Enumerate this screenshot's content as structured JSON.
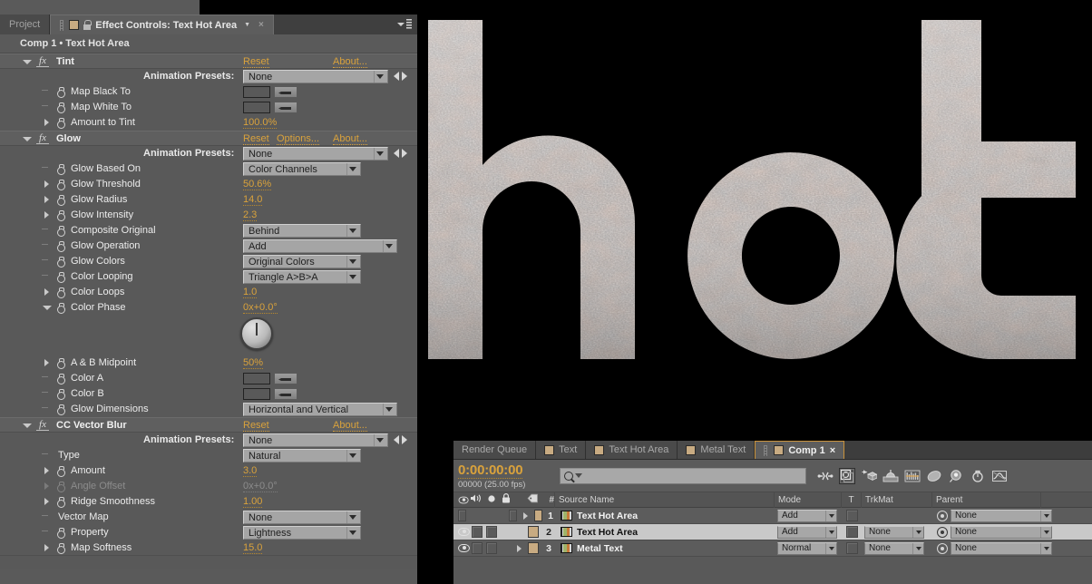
{
  "effect_controls": {
    "tabs": [
      {
        "label": "Project",
        "active": false,
        "icon": null
      },
      {
        "label": "Effect Controls: Text Hot Area",
        "active": true,
        "icon": "swatch-lock"
      }
    ],
    "breadcrumb": "Comp 1 • Text Hot Area",
    "panel_menu_icon": "panel-menu-icon",
    "effects": [
      {
        "name": "Tint",
        "expanded": true,
        "links": [
          "Reset",
          "About..."
        ],
        "animation_presets_label": "Animation Presets:",
        "animation_presets_value": "None",
        "properties": [
          {
            "label": "Map Black To",
            "type": "color",
            "value": "#000000",
            "has_stopwatch": true,
            "expandable": false
          },
          {
            "label": "Map White To",
            "type": "color",
            "value": "#f04516",
            "has_stopwatch": true,
            "expandable": false
          },
          {
            "label": "Amount to Tint",
            "type": "number",
            "value": "100.0%",
            "has_stopwatch": true,
            "expandable": true
          }
        ]
      },
      {
        "name": "Glow",
        "expanded": true,
        "links": [
          "Reset",
          "Options...",
          "About..."
        ],
        "animation_presets_label": "Animation Presets:",
        "animation_presets_value": "None",
        "properties": [
          {
            "label": "Glow Based On",
            "type": "dropdown",
            "value": "Color Channels",
            "has_stopwatch": true,
            "expandable": false,
            "width": 130
          },
          {
            "label": "Glow Threshold",
            "type": "number",
            "value": "50.6%",
            "has_stopwatch": true,
            "expandable": true
          },
          {
            "label": "Glow Radius",
            "type": "number",
            "value": "14.0",
            "has_stopwatch": true,
            "expandable": true
          },
          {
            "label": "Glow Intensity",
            "type": "number",
            "value": "2.3",
            "has_stopwatch": true,
            "expandable": true
          },
          {
            "label": "Composite Original",
            "type": "dropdown",
            "value": "Behind",
            "has_stopwatch": true,
            "expandable": false,
            "width": 130
          },
          {
            "label": "Glow Operation",
            "type": "dropdown",
            "value": "Add",
            "has_stopwatch": true,
            "expandable": false,
            "width": 170
          },
          {
            "label": "Glow Colors",
            "type": "dropdown",
            "value": "Original Colors",
            "has_stopwatch": true,
            "expandable": false,
            "width": 130
          },
          {
            "label": "Color Looping",
            "type": "dropdown",
            "value": "Triangle A>B>A",
            "has_stopwatch": true,
            "expandable": false,
            "width": 130
          },
          {
            "label": "Color Loops",
            "type": "number",
            "value": "1.0",
            "has_stopwatch": true,
            "expandable": true
          },
          {
            "label": "Color Phase",
            "type": "angle",
            "value": "0x+0.0°",
            "has_stopwatch": true,
            "expandable": true,
            "expanded": true,
            "dial": true
          },
          {
            "label": "A & B Midpoint",
            "type": "number",
            "value": "50%",
            "has_stopwatch": true,
            "expandable": true
          },
          {
            "label": "Color A",
            "type": "color",
            "value": "#ffffff",
            "has_stopwatch": true,
            "expandable": false
          },
          {
            "label": "Color B",
            "type": "color",
            "value": "#000000",
            "has_stopwatch": true,
            "expandable": false
          },
          {
            "label": "Glow Dimensions",
            "type": "dropdown",
            "value": "Horizontal and Vertical",
            "has_stopwatch": true,
            "expandable": false,
            "width": 170
          }
        ]
      },
      {
        "name": "CC Vector Blur",
        "expanded": true,
        "links": [
          "Reset",
          "About..."
        ],
        "animation_presets_label": "Animation Presets:",
        "animation_presets_value": "None",
        "properties": [
          {
            "label": "Type",
            "type": "dropdown",
            "value": "Natural",
            "has_stopwatch": false,
            "expandable": false,
            "width": 130
          },
          {
            "label": "Amount",
            "type": "number",
            "value": "3.0",
            "has_stopwatch": true,
            "expandable": true
          },
          {
            "label": "Angle Offset",
            "type": "number",
            "value": "0x+0.0°",
            "has_stopwatch": true,
            "expandable": true,
            "disabled": true
          },
          {
            "label": "Ridge Smoothness",
            "type": "number",
            "value": "1.00",
            "has_stopwatch": true,
            "expandable": true
          },
          {
            "label": "Vector Map",
            "type": "dropdown",
            "value": "None",
            "has_stopwatch": false,
            "expandable": false,
            "width": 130
          },
          {
            "label": "Property",
            "type": "dropdown",
            "value": "Lightness",
            "has_stopwatch": true,
            "expandable": false,
            "width": 130
          },
          {
            "label": "Map Softness",
            "type": "number",
            "value": "15.0",
            "has_stopwatch": true,
            "expandable": true
          }
        ]
      }
    ]
  },
  "viewer": {
    "text": "hot",
    "background": "#000000",
    "anchor_icon": "anchor-point-icon",
    "glow_color": "#ff5a1e"
  },
  "timeline": {
    "tabs": [
      {
        "label": "Render Queue",
        "active": false,
        "has_swatch": false
      },
      {
        "label": "Text",
        "active": false,
        "has_swatch": true
      },
      {
        "label": "Text Hot Area",
        "active": false,
        "has_swatch": true
      },
      {
        "label": "Metal Text",
        "active": false,
        "has_swatch": true
      },
      {
        "label": "Comp 1",
        "active": true,
        "has_swatch": true
      }
    ],
    "timecode": "0:00:00:00",
    "frame_info": "00000 (25.00 fps)",
    "search_placeholder": "",
    "search_value": "",
    "toolbar_icons": [
      "composition-mini-flowchart-icon",
      "draft-3d-icon",
      "motion-blur-icon",
      "brainstorm-icon",
      "graph-editor-icon",
      "frame-blending-icon",
      "shy-icon",
      "auto-keyframe-icon",
      "motion-graph-icon"
    ],
    "columns": [
      "Source Name",
      "Mode",
      "T",
      "TrkMat",
      "Parent"
    ],
    "header_icons": [
      "eye-icon",
      "audio-icon",
      "solo-icon",
      "lock-icon",
      "label-icon",
      "number-icon"
    ],
    "layers": [
      {
        "index": "1",
        "source_name": "Text Hot Area",
        "visible": false,
        "selected": false,
        "mode": "Add",
        "trkmat": "",
        "parent": "None"
      },
      {
        "index": "2",
        "source_name": "Text Hot Area",
        "visible": true,
        "selected": true,
        "mode": "Add",
        "trkmat": "None",
        "parent": "None"
      },
      {
        "index": "3",
        "source_name": "Metal Text",
        "visible": true,
        "selected": false,
        "mode": "Normal",
        "trkmat": "None",
        "parent": "None"
      }
    ]
  },
  "colors": {
    "accent_orange": "#d9a23c",
    "panel_bg": "#595959",
    "selected_row": "#c9c9c9",
    "active_tab_border": "#c9923b"
  }
}
